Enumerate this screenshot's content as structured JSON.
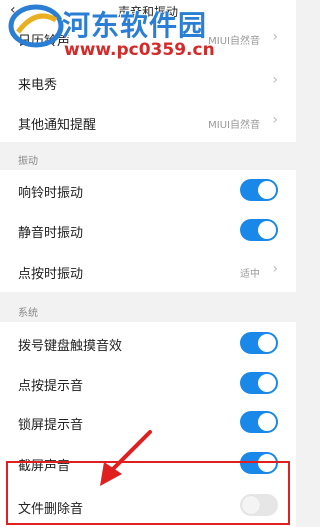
{
  "header": {
    "title": "声音和振动",
    "back_icon": "back-chevron-icon"
  },
  "watermark": {
    "text": "河东软件园",
    "url": "www.pc0359.cn"
  },
  "general": {
    "items": [
      {
        "label": "日历铃声",
        "value": "MIUI自然音"
      },
      {
        "label": "来电秀",
        "value": ""
      },
      {
        "label": "其他通知提醒",
        "value": "MIUI自然音"
      }
    ]
  },
  "vibration": {
    "title": "振动",
    "items": [
      {
        "label": "响铃时振动",
        "on": true
      },
      {
        "label": "静音时振动",
        "on": true
      },
      {
        "label": "点按时振动",
        "value": "适中"
      }
    ]
  },
  "system": {
    "title": "系统",
    "items": [
      {
        "label": "拨号键盘触摸音效",
        "on": true
      },
      {
        "label": "点按提示音",
        "on": true
      },
      {
        "label": "锁屏提示音",
        "on": true
      },
      {
        "label": "截屏声音",
        "on": true
      },
      {
        "label": "文件删除音",
        "on": false
      }
    ]
  },
  "colors": {
    "accent": "#1a88e8",
    "annotation": "#e02020"
  }
}
